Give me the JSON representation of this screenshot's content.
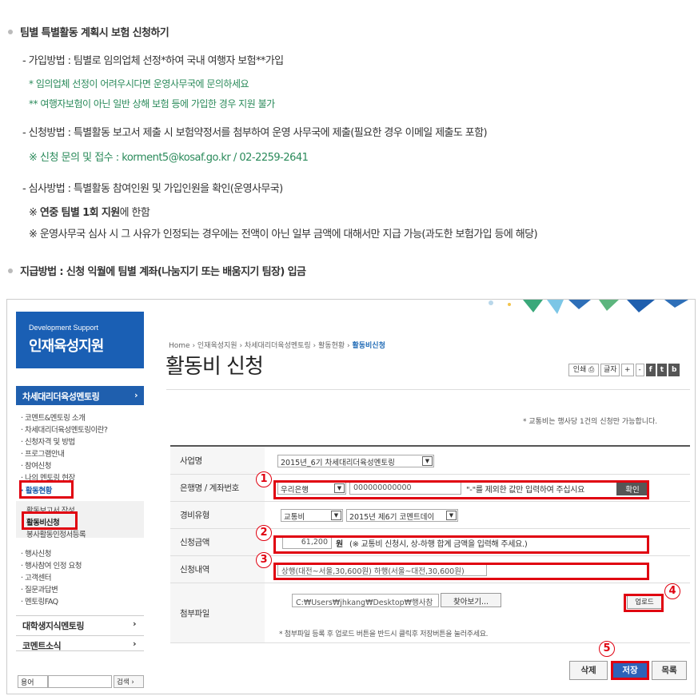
{
  "doc": {
    "b1": "팀별 특별활동 계획시 보험 신청하기",
    "l1": "- 가입방법 : 팀별로 임의업체 선정*하여 국내 여행자 보험**가입",
    "g1": "* 임의업체 선정이 어려우시다면 운영사무국에 문의하세요",
    "g2": "** 여행자보험이 아닌 일반 상해 보험 등에 가입한 경우 지원 불가",
    "l2": "- 신청방법 : 특별활동 보고서 제출 시 보험약정서를 첨부하여 운영 사무국에 제출(필요한 경우 이메일 제출도 포함)",
    "g3": "※ 신청 문의 및 접수 : korment5@kosaf.go.kr / 02-2259-2641",
    "l3": "- 심사방법 : 특별활동 참여인원 및 가입인원을 확인(운영사무국)",
    "n1a": "※ ",
    "n1b": "연중 팀별 1회 지원",
    "n1c": "에 한함",
    "n2": "※ 운영사무국 심사 시 그 사유가 인정되는 경우에는 전액이 아닌 일부 금액에 대해서만 지급 가능(과도한 보험가입 등에 해당)",
    "b2": "지급방법 : 신청 익월에 팀별 계좌(나눔지기 또는 배움지기 팀장) 입금"
  },
  "shot": {
    "banner_en": "Development Support",
    "banner_ko": "인재육성지원",
    "lnav_head": "차세대리더육성멘토링",
    "sub1": [
      "· 코멘트&멘토링 소개",
      "· 차세대리더육성멘토링이란?",
      "· 신청자격 및 방법",
      "· 프로그램안내",
      "· 참여신청",
      "· 나의 멘토링 현장"
    ],
    "active": "· 활동현황",
    "sub2a": "활동보고서 작성",
    "sub2b": "활동비신청",
    "sub2c": "봉사활동인정서등록",
    "sub3": [
      "· 행사신청",
      "· 행사참여 인정 요청",
      "· 고객센터",
      "· 질문과답변",
      "· 멘토링FAQ"
    ],
    "nav2a": "대학생지식멘토링",
    "nav2b": "코멘트소식",
    "arrow": "›",
    "search_label": "용어",
    "search_btn": "검색 ›",
    "crumb_pre": "Home › 인재육성지원 › 차세대리더육성멘토링 › 활동현황 › ",
    "crumb_cur": "활동비신청",
    "title": "활동비 신청",
    "tool_print": "인쇄",
    "tool_font": "글자",
    "tool_plus": "+",
    "tool_minus": "-",
    "tool_f": "f",
    "tool_t": "t",
    "tool_b": "b",
    "info": "* 교통비는 행사당 1건의 신청만 가능합니다.",
    "r1_label": "사업명",
    "r1_value": "2015년_6기 차세대리더육성멘토링",
    "r2_label": "은행명 / 계좌번호",
    "r2_bank": "우리은행",
    "r2_acct": "000000000000",
    "r2_hint": "\"-\"를 제외한 값만 입력하여 주십시요",
    "r2_btn": "확인",
    "r3_label": "경비유형",
    "r3_type": "교통비",
    "r3_event": "2015년 제6기 코멘트데이",
    "r4_label": "신청금액",
    "r4_amount": "61,200",
    "r4_unit": "원",
    "r4_note": "(※ 교통비 신청시, 상-하행 합계 금액을 입력해 주세요.)",
    "r5_label": "신청내역",
    "r5_value": "상행(대전~서울,30,600원) 하행(서울~대전,30,600원)",
    "r6_label": "첨부파일",
    "r6_path": "C:₩Users₩jhkang₩Desktop₩행사참",
    "r6_browse": "찾아보기...",
    "r6_upload": "업로드",
    "r6_note": "* 첨부파일 등록 후 업로드 버튼을 반드시 클릭후 저장버튼을 눌러주세요.",
    "btn_delete": "삭제",
    "btn_save": "저장",
    "btn_list": "목록",
    "n1": "1",
    "n2": "2",
    "n3": "3",
    "n4": "4",
    "n5": "5"
  },
  "colors": {
    "accent_red": "#e00010",
    "brand_blue": "#1a5fb4",
    "green_text": "#2a8a5a"
  }
}
